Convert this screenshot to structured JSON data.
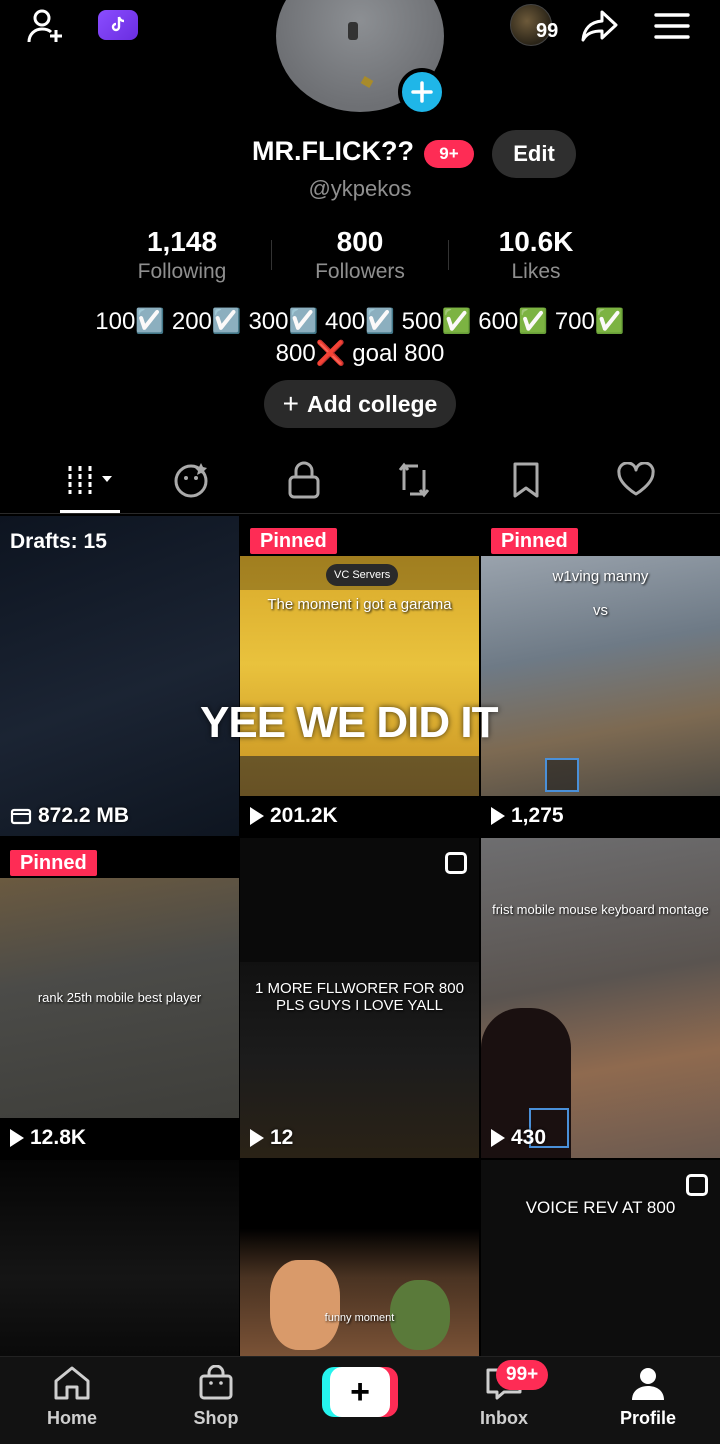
{
  "topbar": {
    "avatar_count": "99"
  },
  "profile": {
    "username": "MR.FLICK??",
    "badge": "9+",
    "edit_label": "Edit",
    "handle": "@ykpekos",
    "stats": [
      {
        "value": "1,148",
        "label": "Following"
      },
      {
        "value": "800",
        "label": "Followers"
      },
      {
        "value": "10.6K",
        "label": "Likes"
      }
    ],
    "bio_line1": "100☑️ 200☑️ 300☑️ 400☑️ 500✅ 600✅ 700✅",
    "bio_line2": "800❌ goal 800",
    "add_college_label": "Add college"
  },
  "grid": {
    "overlay_text": "YEE WE DID IT",
    "cells": [
      {
        "drafts_label": "Drafts: 15",
        "size": "872.2 MB"
      },
      {
        "pinned": "Pinned",
        "caption": "The moment i got a garama",
        "tag": "VC Servers",
        "views": "201.2K"
      },
      {
        "pinned": "Pinned",
        "caption": "w1ving manny",
        "vs": "vs",
        "views": "1,275"
      },
      {
        "pinned": "Pinned",
        "caption": "rank 25th mobile best player",
        "views": "12.8K"
      },
      {
        "caption": "1 MORE FLLWORER FOR 800 PLS GUYS I LOVE YALL",
        "views": "12"
      },
      {
        "caption": "frist mobile mouse keyboard montage",
        "views": "430"
      },
      {
        "caption": ""
      },
      {
        "caption": "funny moment"
      },
      {
        "caption": "VOICE REV AT 800"
      }
    ]
  },
  "bottomnav": {
    "home": "Home",
    "shop": "Shop",
    "create": "+",
    "inbox": "Inbox",
    "inbox_badge": "99+",
    "profile": "Profile"
  }
}
